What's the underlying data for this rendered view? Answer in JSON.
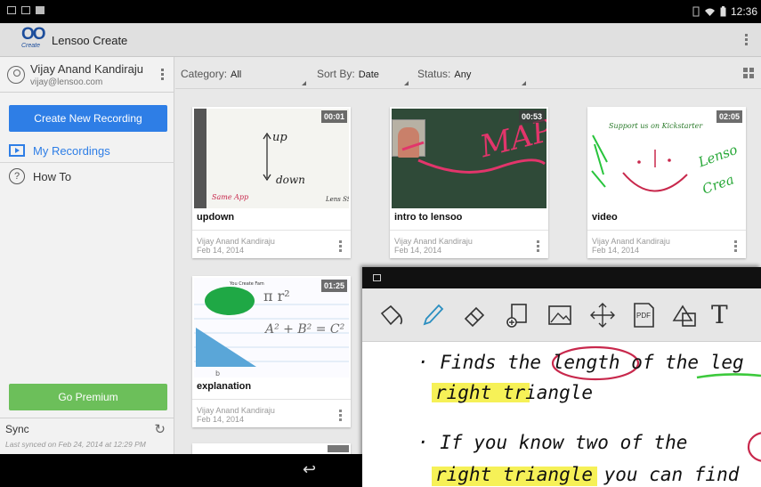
{
  "status_bar": {
    "time": "12:36"
  },
  "app": {
    "title": "Lensoo Create",
    "logo_text": "OO",
    "logo_sub": "Create"
  },
  "user": {
    "name": "Vijay Anand Kandiraju",
    "email": "vijay@lensoo.com"
  },
  "drawer": {
    "create_label": "Create New Recording",
    "items": [
      {
        "label": "My Recordings",
        "icon": "tv-play-icon",
        "selected": true
      },
      {
        "label": "How To",
        "icon": "question-icon",
        "selected": false
      }
    ],
    "premium_label": "Go Premium",
    "sync_label": "Sync",
    "sync_meta": "Last synced on Feb 24, 2014 at 12:29 PM"
  },
  "filters": {
    "category_label": "Category:",
    "category_value": "All",
    "sort_label": "Sort By:",
    "sort_value": "Date",
    "status_label": "Status:",
    "status_value": "Any"
  },
  "recordings": [
    {
      "title": "updown",
      "duration": "00:01",
      "author": "Vijay Anand Kandiraju",
      "date": "Feb 14, 2014"
    },
    {
      "title": "intro to lensoo",
      "duration": "00:53",
      "author": "Vijay Anand Kandiraju",
      "date": "Feb 14, 2014"
    },
    {
      "title": "video",
      "duration": "02:05",
      "author": "Vijay Anand Kandiraju",
      "date": "Feb 14, 2014"
    },
    {
      "title": "explanation",
      "duration": "01:25",
      "author": "Vijay Anand Kandiraju",
      "date": "Feb 14, 2014"
    }
  ],
  "overlay": {
    "tools": [
      "bucket-icon",
      "pen-icon",
      "eraser-icon",
      "add-page-icon",
      "image-icon",
      "move-icon",
      "pdf-icon",
      "shapes-icon",
      "text-icon"
    ],
    "pdf_label": "PDF",
    "text_tool_label": "T",
    "note_lines": [
      "· Finds the length of the leg",
      "right triangle",
      "· If you know two of the",
      "right triangle you can find"
    ]
  },
  "thumb_text": {
    "updown_up": "up",
    "updown_down": "down",
    "updown_corner_left": "Same App",
    "updown_corner_right": "Lens SSC",
    "intro_scribble": "MAP",
    "video_top": "Support us on Kickstarter",
    "video_side_1": "Lenso",
    "video_side_2": "Crea",
    "explanation_header": "You Create Fam",
    "explanation_pi": "π r²",
    "explanation_eq": "A² + B² = C²",
    "explanation_mark": "b"
  },
  "colors": {
    "accent": "#2e7ee6",
    "premium": "#6cbf5a",
    "highlight": "#f5ef3a",
    "circle": "#c8284c",
    "underline": "#3cc93c"
  }
}
